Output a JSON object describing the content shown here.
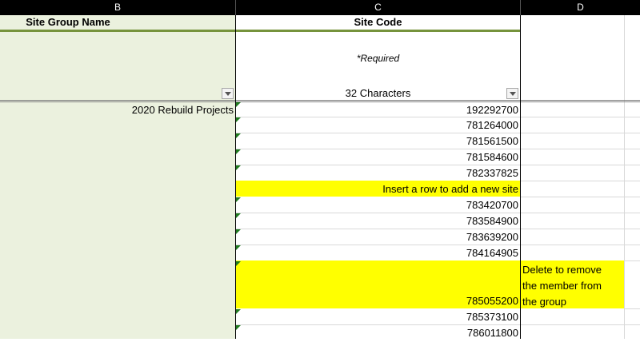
{
  "columns": [
    "B",
    "C",
    "D"
  ],
  "headers": {
    "site_group_name": "Site Group Name",
    "site_code": "Site Code"
  },
  "filter_row": {
    "required": "*Required",
    "chars": "32 Characters"
  },
  "group_name": "2020 Rebuild Projects",
  "site_codes": [
    "192292700",
    "781264000",
    "781561500",
    "781584600",
    "782337825",
    "783420700",
    "783584900",
    "783639200",
    "784164905",
    "785055200",
    "785373100",
    "786011800"
  ],
  "notes": {
    "insert": "Insert a row to add a new site",
    "delete": [
      "Delete to remove",
      "the member from",
      "the group"
    ]
  },
  "colors": {
    "accent_green_line": "#76933c",
    "left_fill": "#ebf1de",
    "highlight": "#ffff00",
    "comment_triangle": "#1f7a1f"
  }
}
